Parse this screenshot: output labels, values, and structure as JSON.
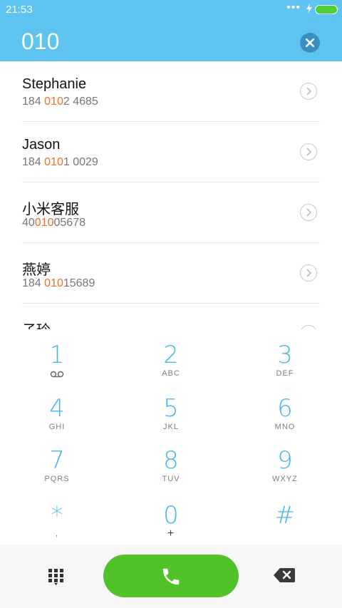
{
  "status_bar": {
    "time": "21:53",
    "dots": "•••",
    "battery_color": "#4cd137"
  },
  "search": {
    "value": "010",
    "clear_icon": "close-icon"
  },
  "contacts": [
    {
      "name": "Stephanie",
      "number_pre": "184 ",
      "number_hl": "010",
      "number_post": "2 4685"
    },
    {
      "name": "Jason",
      "number_pre": "184 ",
      "number_hl": "010",
      "number_post": "1 0029"
    },
    {
      "name": "小米客服",
      "number_pre": "40",
      "number_hl": "010",
      "number_post": "05678"
    },
    {
      "name": "燕婷",
      "number_pre": "184 ",
      "number_hl": "010",
      "number_post": "15689"
    },
    {
      "name": "子玲",
      "number_pre": "",
      "number_hl": "",
      "number_post": ""
    }
  ],
  "dialpad": {
    "keys": [
      {
        "digit": "1",
        "letters": ""
      },
      {
        "digit": "2",
        "letters": "ABC"
      },
      {
        "digit": "3",
        "letters": "DEF"
      },
      {
        "digit": "4",
        "letters": "GHI"
      },
      {
        "digit": "5",
        "letters": "JKL"
      },
      {
        "digit": "6",
        "letters": "MNO"
      },
      {
        "digit": "7",
        "letters": "PQRS"
      },
      {
        "digit": "8",
        "letters": "TUV"
      },
      {
        "digit": "9",
        "letters": "WXYZ"
      },
      {
        "digit": "*",
        "letters": ","
      },
      {
        "digit": "0",
        "letters": "+"
      },
      {
        "digit": "#",
        "letters": ""
      }
    ]
  },
  "colors": {
    "accent": "#5ec4ef",
    "highlight": "#f26b2a",
    "call": "#52c229"
  }
}
